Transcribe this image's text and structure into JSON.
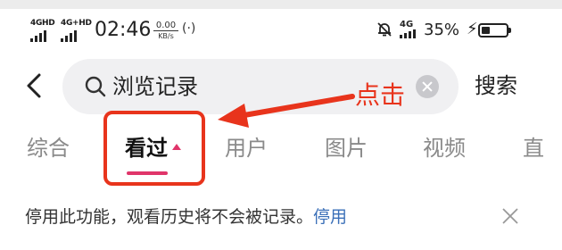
{
  "status_bar": {
    "network1": "4GHD",
    "network2": "4G+HD",
    "time": "02:46",
    "speed_value": "0.00",
    "speed_unit": "KB/s",
    "hotspot_glyph": "(·)",
    "network3": "4G",
    "battery_percent": "35%",
    "battery_level": 0.35,
    "charging": true
  },
  "search": {
    "query": "浏览记录",
    "submit_label": "搜索"
  },
  "annotation": {
    "label": "点击",
    "color": "#e8341c"
  },
  "tabs": [
    {
      "label": "综合",
      "active": false
    },
    {
      "label": "看过",
      "active": true
    },
    {
      "label": "用户",
      "active": false
    },
    {
      "label": "图片",
      "active": false
    },
    {
      "label": "视频",
      "active": false
    },
    {
      "label": "直",
      "active": false
    }
  ],
  "notice": {
    "text": "停用此功能，观看历史将不会被记录。",
    "link": "停用"
  },
  "colors": {
    "accent": "#e0356a",
    "link": "#3a6fb8"
  },
  "icons": [
    "back-arrow-icon",
    "search-icon",
    "clear-icon",
    "close-icon",
    "do-not-disturb-icon",
    "battery-icon",
    "charging-icon",
    "hotspot-icon"
  ]
}
